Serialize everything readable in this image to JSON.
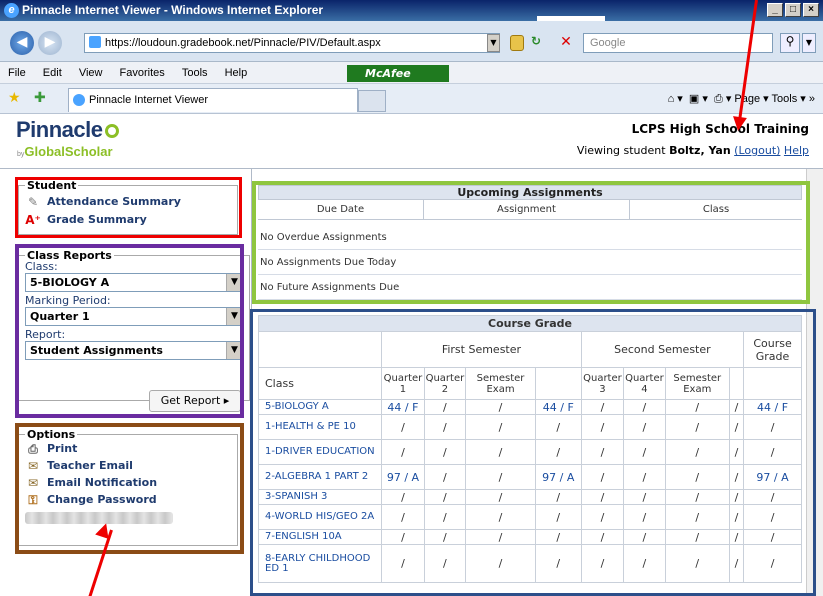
{
  "browser": {
    "title": "Pinnacle Internet Viewer - Windows Internet Explorer",
    "url": "https://loudoun.gradebook.net/Pinnacle/PIV/Default.aspx",
    "search_placeholder": "Google",
    "menu": [
      "File",
      "Edit",
      "View",
      "Favorites",
      "Tools",
      "Help"
    ],
    "mcafee": "McAfee",
    "tab_title": "Pinnacle Internet Viewer",
    "tools_right": "Page ▾   Tools ▾"
  },
  "header": {
    "logo": "Pinnacle",
    "logo_sub_by": "by",
    "logo_sub": "GlobalScholar",
    "school": "LCPS High School Training",
    "viewing_prefix": "Viewing student",
    "student_name": "Boltz, Yan",
    "logout": "(Logout)",
    "help": "Help"
  },
  "sidebar": {
    "student_legend": "Student",
    "attendance": "Attendance Summary",
    "grade_summary": "Grade Summary",
    "reports_legend": "Class Reports",
    "class_label": "Class:",
    "class_value": "5-BIOLOGY A",
    "period_label": "Marking Period:",
    "period_value": "Quarter 1",
    "report_label": "Report:",
    "report_value": "Student Assignments",
    "get_report": "Get Report ▸",
    "options_legend": "Options",
    "print": "Print",
    "teacher_email": "Teacher Email",
    "email_notification": "Email Notification",
    "change_password": "Change Password"
  },
  "upcoming": {
    "title": "Upcoming Assignments",
    "columns": [
      "Due Date",
      "Assignment",
      "Class"
    ],
    "messages": [
      "No Overdue Assignments",
      "No Assignments Due Today",
      "No Future Assignments Due"
    ]
  },
  "course_grade": {
    "title": "Course Grade",
    "first_semester": "First Semester",
    "second_semester": "Second Semester",
    "course_grade_header": "Course Grade",
    "class_header": "Class",
    "q1": "Quarter 1",
    "q2": "Quarter 2",
    "sem_exam": "Semester Exam",
    "q3": "Quarter 3",
    "q4": "Quarter 4",
    "sem_exam2": "Semester Exam",
    "rows": [
      {
        "class": "5-BIOLOGY A",
        "q1": "44 / F",
        "q2": "/",
        "e1": "/",
        "s1": "44 / F",
        "q3": "/",
        "q4": "/",
        "e2": "/",
        "s2": "/",
        "cg": "44 / F"
      },
      {
        "class": "1-HEALTH & PE 10",
        "q1": "/",
        "q2": "/",
        "e1": "/",
        "s1": "/",
        "q3": "/",
        "q4": "/",
        "e2": "/",
        "s2": "/",
        "cg": "/"
      },
      {
        "class": "1-DRIVER EDUCATION",
        "q1": "/",
        "q2": "/",
        "e1": "/",
        "s1": "/",
        "q3": "/",
        "q4": "/",
        "e2": "/",
        "s2": "/",
        "cg": "/"
      },
      {
        "class": "2-ALGEBRA 1 PART 2",
        "q1": "97 / A",
        "q2": "/",
        "e1": "/",
        "s1": "97 / A",
        "q3": "/",
        "q4": "/",
        "e2": "/",
        "s2": "/",
        "cg": "97 / A"
      },
      {
        "class": "3-SPANISH 3",
        "q1": "/",
        "q2": "/",
        "e1": "/",
        "s1": "/",
        "q3": "/",
        "q4": "/",
        "e2": "/",
        "s2": "/",
        "cg": "/"
      },
      {
        "class": "4-WORLD HIS/GEO 2A",
        "q1": "/",
        "q2": "/",
        "e1": "/",
        "s1": "/",
        "q3": "/",
        "q4": "/",
        "e2": "/",
        "s2": "/",
        "cg": "/"
      },
      {
        "class": "7-ENGLISH 10A",
        "q1": "/",
        "q2": "/",
        "e1": "/",
        "s1": "/",
        "q3": "/",
        "q4": "/",
        "e2": "/",
        "s2": "/",
        "cg": "/"
      },
      {
        "class": "8-EARLY CHILDHOOD ED 1",
        "q1": "/",
        "q2": "/",
        "e1": "/",
        "s1": "/",
        "q3": "/",
        "q4": "/",
        "e2": "/",
        "s2": "/",
        "cg": "/"
      }
    ]
  },
  "colors": {
    "annotation_red": "#ee0000",
    "annotation_purple": "#6a2ca0",
    "annotation_brown": "#8b4c16",
    "annotation_green": "#8fc63f",
    "annotation_navy": "#2c4f8a"
  }
}
